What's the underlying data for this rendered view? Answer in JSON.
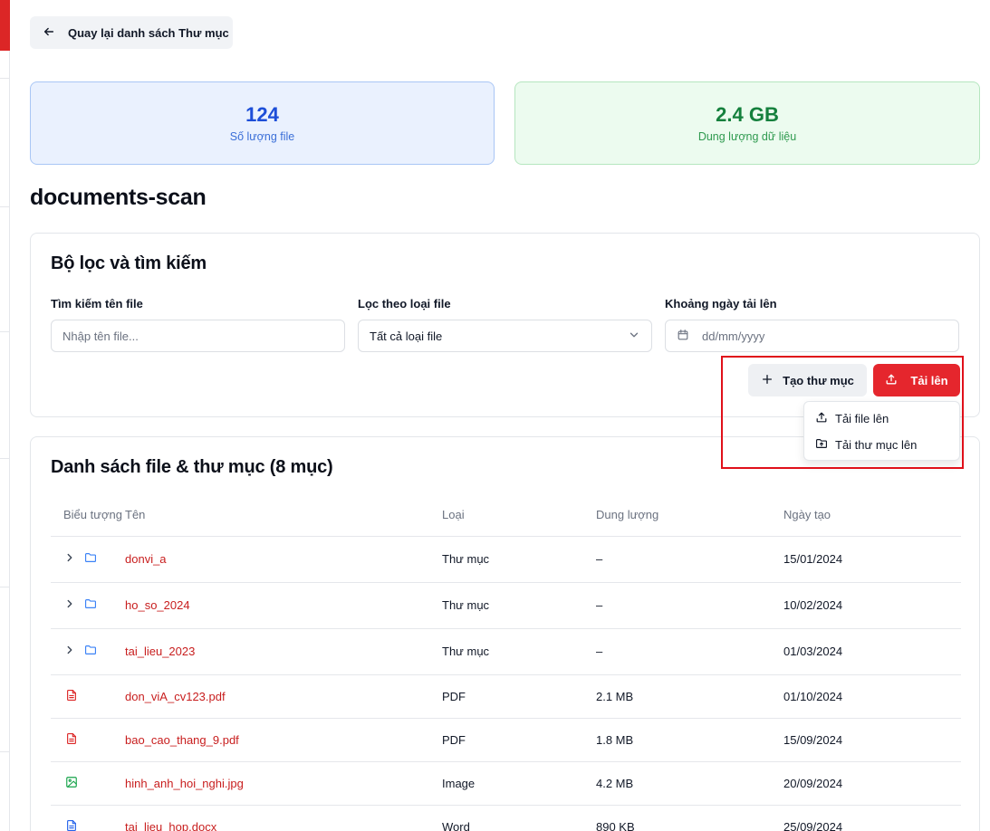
{
  "back_button": {
    "label": "Quay lại danh sách Thư mục"
  },
  "stats": [
    {
      "value": "124",
      "label": "Số lượng file",
      "color": "#1d4ed8"
    },
    {
      "value": "2.4 GB",
      "label": "Dung lượng dữ liệu",
      "color": "#15803d"
    }
  ],
  "folder": {
    "title": "documents-scan"
  },
  "filters": {
    "title": "Bộ lọc và tìm kiếm",
    "search": {
      "label": "Tìm kiếm tên file",
      "placeholder": "Nhập tên file..."
    },
    "type": {
      "label": "Lọc theo loại file",
      "selected": "Tất cả loại file"
    },
    "date": {
      "label": "Khoảng ngày tải lên",
      "placeholder": "dd/mm/yyyy"
    }
  },
  "actions": {
    "create_folder": "Tạo thư mục",
    "upload": "Tải lên",
    "upload_menu": [
      "Tải file lên",
      "Tải thư mục lên"
    ]
  },
  "list": {
    "title": "Danh sách file & thư mục (8 mục)",
    "columns": [
      "Biểu tượng",
      "Tên",
      "Loại",
      "Dung lượng",
      "Ngày tạo"
    ],
    "rows": [
      {
        "icon": "folder-icon",
        "name": "donvi_a",
        "type": "Thư mục",
        "size": "–",
        "date": "15/01/2024"
      },
      {
        "icon": "folder-icon",
        "name": "ho_so_2024",
        "type": "Thư mục",
        "size": "–",
        "date": "10/02/2024"
      },
      {
        "icon": "folder-icon",
        "name": "tai_lieu_2023",
        "type": "Thư mục",
        "size": "–",
        "date": "01/03/2024"
      },
      {
        "icon": "pdf-file-icon",
        "name": "don_viA_cv123.pdf",
        "type": "PDF",
        "size": "2.1 MB",
        "date": "01/10/2024"
      },
      {
        "icon": "pdf-file-icon",
        "name": "bao_cao_thang_9.pdf",
        "type": "PDF",
        "size": "1.8 MB",
        "date": "15/09/2024"
      },
      {
        "icon": "image-file-icon",
        "name": "hinh_anh_hoi_nghi.jpg",
        "type": "Image",
        "size": "4.2 MB",
        "date": "20/09/2024"
      },
      {
        "icon": "word-file-icon",
        "name": "tai_lieu_hop.docx",
        "type": "Word",
        "size": "890 KB",
        "date": "25/09/2024"
      }
    ]
  },
  "colors": {
    "accent": "#e5262d",
    "link": "#c81e1e",
    "folder": "#3b82f6",
    "image": "#16a34a",
    "word": "#2563eb"
  }
}
